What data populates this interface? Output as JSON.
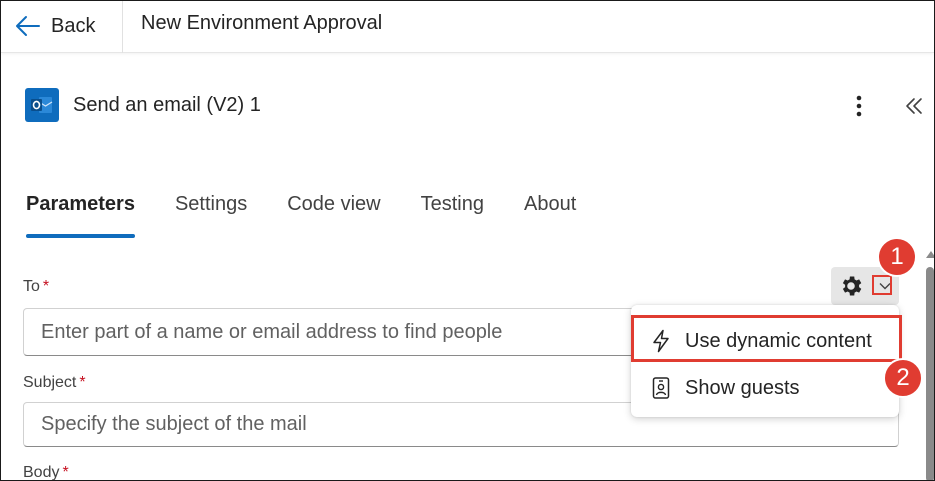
{
  "topbar": {
    "back_label": "Back",
    "title": "New Environment Approval"
  },
  "action": {
    "title": "Send an email (V2) 1",
    "icon": "outlook-icon",
    "more_icon": "more-vertical-icon",
    "collapse_icon": "double-chevron-left-icon"
  },
  "tabs": [
    {
      "label": "Parameters",
      "active": true
    },
    {
      "label": "Settings",
      "active": false
    },
    {
      "label": "Code view",
      "active": false
    },
    {
      "label": "Testing",
      "active": false
    },
    {
      "label": "About",
      "active": false
    }
  ],
  "fields": {
    "to": {
      "label": "To",
      "required_mark": "*",
      "placeholder": "Enter part of a name or email address to find people"
    },
    "subject": {
      "label": "Subject",
      "required_mark": "*",
      "placeholder": "Specify the subject of the mail"
    },
    "body": {
      "label": "Body",
      "required_mark": "*"
    }
  },
  "menu": {
    "items": [
      {
        "label": "Use dynamic content",
        "icon": "lightning-icon"
      },
      {
        "label": "Show guests",
        "icon": "guest-badge-icon"
      }
    ]
  },
  "callouts": [
    "1",
    "2"
  ],
  "colors": {
    "accent": "#0f6cbd",
    "callout_red": "#e03c31",
    "required_red": "#c50f1f"
  }
}
